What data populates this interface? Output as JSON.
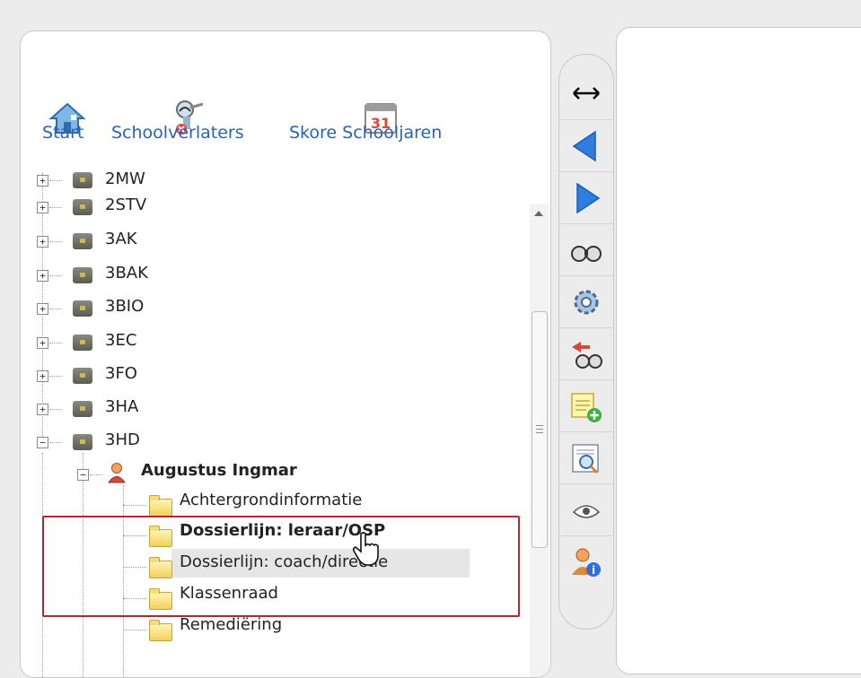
{
  "nav": {
    "start": "Start",
    "schoolverlaters": "Schoolverlaters",
    "skore": "Skore Schooljaren",
    "calendar_day": "31"
  },
  "tree": {
    "partial_label": "2MW",
    "classes": [
      "2STV",
      "3AK",
      "3BAK",
      "3BIO",
      "3EC",
      "3FO",
      "3HA",
      "3HD"
    ],
    "student": "Augustus Ingmar",
    "folders": [
      "Achtergrondinformatie",
      "Dossierlijn: leraar/OSP",
      "Dossierlijn: coach/directie",
      "Klassenraad",
      "Remediëring"
    ]
  },
  "toolbar": {
    "icons": [
      "resize-icon",
      "back-icon",
      "forward-icon",
      "binoculars-icon",
      "settings-icon",
      "search-back-icon",
      "note-add-icon",
      "preview-icon",
      "eye-icon",
      "user-info-icon"
    ]
  },
  "colors": {
    "accent": "#2a62b8",
    "highlight": "#b3282e"
  }
}
